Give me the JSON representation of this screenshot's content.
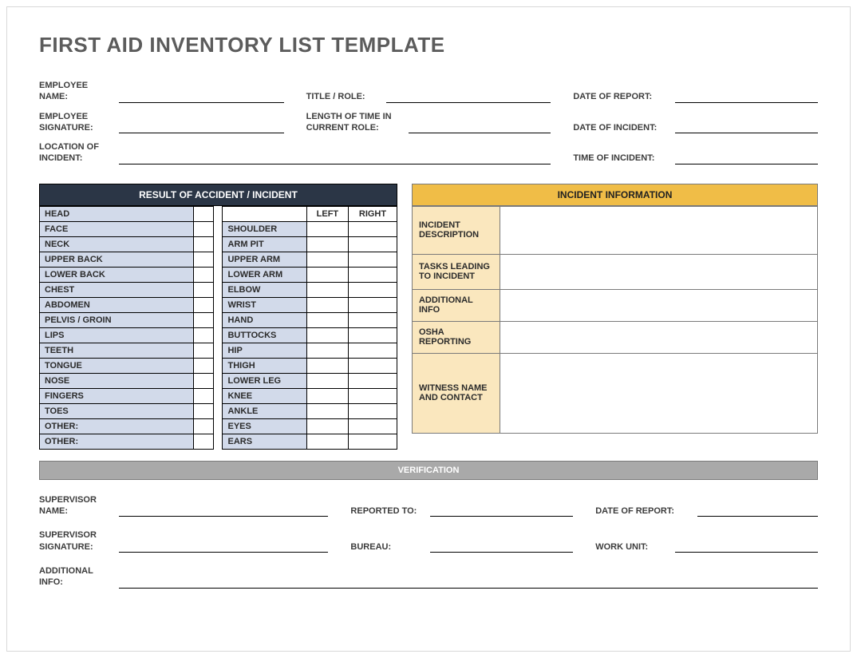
{
  "title": "FIRST AID INVENTORY LIST TEMPLATE",
  "top_fields": {
    "emp_name": "EMPLOYEE NAME:",
    "title_role": "TITLE / ROLE:",
    "date_report": "DATE OF REPORT:",
    "emp_sig": "EMPLOYEE SIGNATURE:",
    "length_role": "LENGTH OF TIME IN CURRENT ROLE:",
    "date_incident": "DATE OF INCIDENT:",
    "loc_incident": "LOCATION OF INCIDENT:",
    "time_incident": "TIME OF INCIDENT:"
  },
  "result_header": "RESULT OF ACCIDENT / INCIDENT",
  "body_left": [
    "HEAD",
    "FACE",
    "NECK",
    "UPPER BACK",
    "LOWER BACK",
    "CHEST",
    "ABDOMEN",
    "PELVIS / GROIN",
    "LIPS",
    "TEETH",
    "TONGUE",
    "NOSE",
    "FINGERS",
    "TOES",
    "OTHER:",
    "OTHER:"
  ],
  "lr_heads": {
    "left": "LEFT",
    "right": "RIGHT"
  },
  "body_right": [
    "SHOULDER",
    "ARM PIT",
    "UPPER ARM",
    "LOWER ARM",
    "ELBOW",
    "WRIST",
    "HAND",
    "BUTTOCKS",
    "HIP",
    "THIGH",
    "LOWER LEG",
    "KNEE",
    "ANKLE",
    "EYES",
    "EARS"
  ],
  "incident_header": "INCIDENT INFORMATION",
  "incident_rows": {
    "desc": "INCIDENT DESCRIPTION",
    "tasks": "TASKS LEADING TO INCIDENT",
    "addl": "ADDITIONAL INFO",
    "osha": "OSHA REPORTING",
    "witness": "WITNESS NAME AND CONTACT"
  },
  "verification_header": "VERIFICATION",
  "ver_fields": {
    "sup_name": "SUPERVISOR NAME:",
    "reported_to": "REPORTED TO:",
    "date_report": "DATE OF REPORT:",
    "sup_sig": "SUPERVISOR SIGNATURE:",
    "bureau": "BUREAU:",
    "work_unit": "WORK UNIT:",
    "addl_info": "ADDITIONAL INFO:"
  }
}
